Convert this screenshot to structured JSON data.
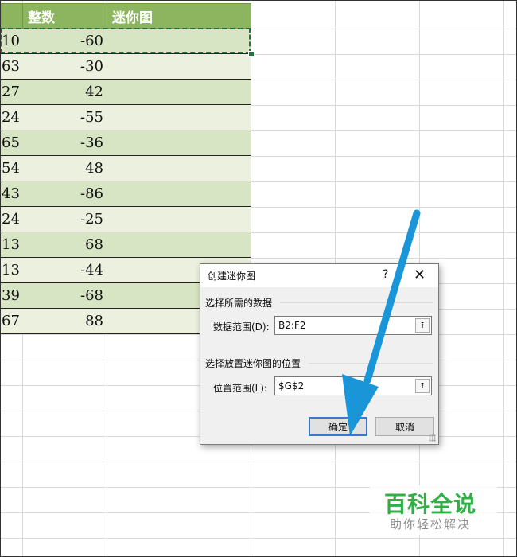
{
  "sheet": {
    "header": {
      "col_b": "整数",
      "col_c": "迷你图"
    },
    "rows": [
      {
        "a": "10",
        "b": "-60"
      },
      {
        "a": "63",
        "b": "-30"
      },
      {
        "a": "27",
        "b": "42"
      },
      {
        "a": "24",
        "b": "-55"
      },
      {
        "a": "65",
        "b": "-36"
      },
      {
        "a": "54",
        "b": "48"
      },
      {
        "a": "43",
        "b": "-86"
      },
      {
        "a": "24",
        "b": "-25"
      },
      {
        "a": "13",
        "b": "68"
      },
      {
        "a": "13",
        "b": "-44"
      },
      {
        "a": "39",
        "b": "-68"
      },
      {
        "a": "67",
        "b": "88"
      }
    ],
    "accent": "#8db560"
  },
  "dialog": {
    "title": "创建迷你图",
    "help": "?",
    "close": "✕",
    "data_section": "选择所需的数据",
    "data_range_label": "数据范围(D):",
    "data_range_value": "B2:F2",
    "location_section": "选择放置迷你图的位置",
    "location_range_label": "位置范围(L):",
    "location_range_value": "$G$2",
    "ok_label": "确定",
    "cancel_label": "取消",
    "pick_icon": "collapse-dialog-icon"
  },
  "watermark": {
    "title": "百科全说",
    "subtitle": "助你轻松解决"
  },
  "arrow_color": "#1a96d8"
}
